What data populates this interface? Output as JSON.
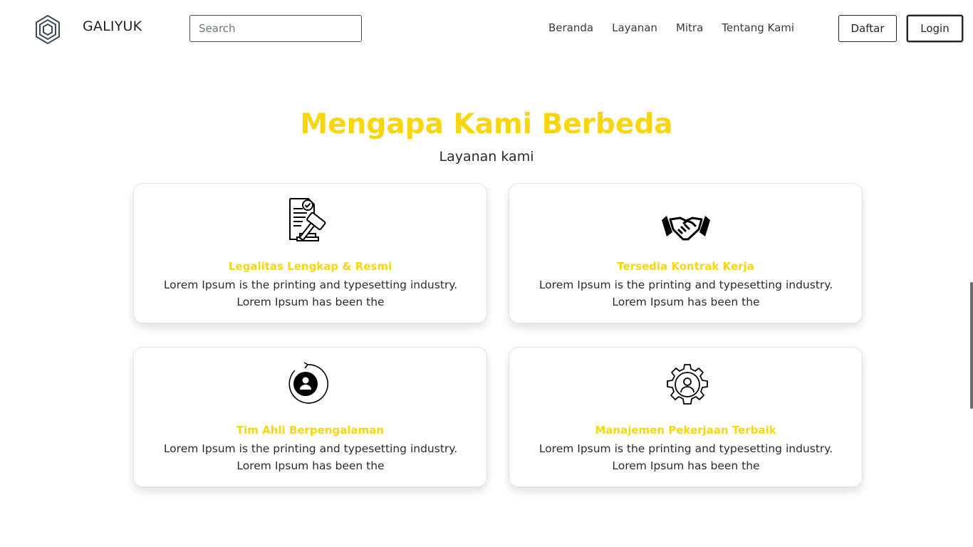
{
  "navbar": {
    "logo_icon": "hexagon-logo-icon",
    "brand": "GALIYUK",
    "search": {
      "placeholder": "Search",
      "value": ""
    },
    "links": [
      "Beranda",
      "Layanan",
      "Mitra",
      "Tentang Kami"
    ],
    "register_label": "Daftar",
    "login_label": "Login"
  },
  "section": {
    "title": "Mengapa Kami Berbeda",
    "subtitle": "Layanan kami",
    "accent_color": "#f7d60f",
    "cards": [
      {
        "icon": "legal-document-gavel-icon",
        "title": "Legalitas Lengkap & Resmi",
        "text": "Lorem Ipsum is the printing and typesetting industry. Lorem Ipsum has been the"
      },
      {
        "icon": "handshake-icon",
        "title": "Tersedia Kontrak Kerja",
        "text": "Lorem Ipsum is the printing and typesetting industry. Lorem Ipsum has been the"
      },
      {
        "icon": "user-refresh-icon",
        "title": "Tim Ahli Berpengalaman",
        "text": "Lorem Ipsum is the printing and typesetting industry. Lorem Ipsum has been the"
      },
      {
        "icon": "user-gear-icon",
        "title": "Manajemen Pekerjaan Terbaik",
        "text": "Lorem Ipsum is the printing and typesetting industry. Lorem Ipsum has been the"
      }
    ]
  }
}
